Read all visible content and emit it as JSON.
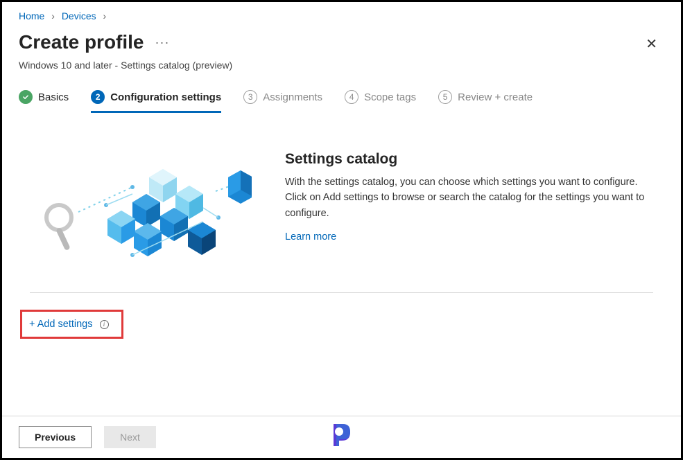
{
  "breadcrumb": {
    "home": "Home",
    "devices": "Devices"
  },
  "header": {
    "title": "Create profile",
    "subtitle": "Windows 10 and later - Settings catalog (preview)"
  },
  "tabs": {
    "basics": "Basics",
    "config_num": "2",
    "config": "Configuration settings",
    "assign_num": "3",
    "assign": "Assignments",
    "scope_num": "4",
    "scope": "Scope tags",
    "review_num": "5",
    "review": "Review + create"
  },
  "catalog": {
    "title": "Settings catalog",
    "desc": "With the settings catalog, you can choose which settings you want to configure. Click on Add settings to browse or search the catalog for the settings you want to configure.",
    "learn": "Learn more"
  },
  "add_settings": "+ Add settings",
  "footer": {
    "previous": "Previous",
    "next": "Next"
  }
}
